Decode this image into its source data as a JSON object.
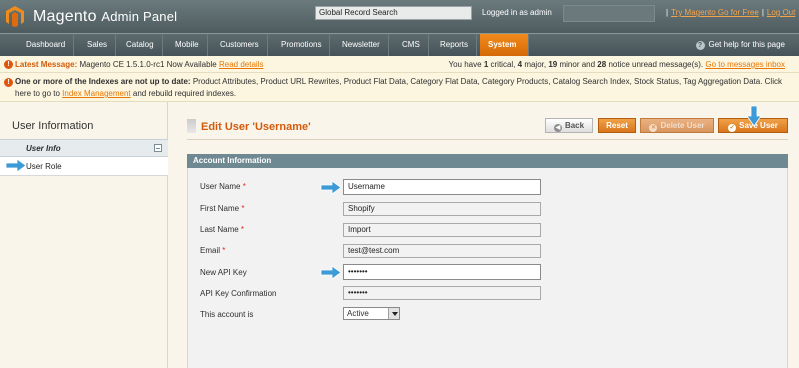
{
  "header": {
    "logo_brand": "Magento",
    "logo_suffix": "Admin Panel",
    "global_search": "Global Record Search",
    "logged_in": "Logged in as admin",
    "try_link": "Try Magento Go for Free",
    "logout_link": "Log Out"
  },
  "nav": {
    "items": [
      "Dashboard",
      "Sales",
      "Catalog",
      "Mobile",
      "Customers",
      "Promotions",
      "Newsletter",
      "CMS",
      "Reports",
      "System"
    ],
    "active": "System",
    "help": "Get help for this page"
  },
  "messages": {
    "latest_label": "Latest Message:",
    "latest_text": "Magento CE 1.5.1.0-rc1 Now Available",
    "read_details": "Read details",
    "unread_you_have": "You have",
    "unread_critical_num": "1",
    "unread_critical": "critical,",
    "unread_major_num": "4",
    "unread_major": "major,",
    "unread_minor_num": "19",
    "unread_minor": "minor and",
    "unread_notice_num": "28",
    "unread_notice": "notice unread message(s).",
    "inbox_link": "Go to messages inbox",
    "index_bold": "One or more of the Indexes are not up to date:",
    "index_text": "Product Attributes, Product URL Rewrites, Product Flat Data, Category Flat Data, Category Products, Catalog Search Index, Stock Status, Tag Aggregation Data. Click here to go to",
    "index_link": "Index Management",
    "index_tail": "and rebuild required indexes."
  },
  "sidebar": {
    "title": "User Information",
    "tabs": [
      "User Info",
      "User Role"
    ]
  },
  "page": {
    "title": "Edit User 'Username'",
    "buttons": {
      "back": "Back",
      "reset": "Reset",
      "delete": "Delete User",
      "save": "Save User"
    }
  },
  "form": {
    "section_title": "Account Information",
    "fields": [
      {
        "label": "User Name",
        "required": true,
        "value": "Username"
      },
      {
        "label": "First Name",
        "required": true,
        "value": "Shopify"
      },
      {
        "label": "Last Name",
        "required": true,
        "value": "Import"
      },
      {
        "label": "Email",
        "required": true,
        "value": "test@test.com"
      },
      {
        "label": "New API Key",
        "required": false,
        "value": "•••••••"
      },
      {
        "label": "API Key Confirmation",
        "required": false,
        "value": "•••••••"
      },
      {
        "label": "This account is",
        "required": false,
        "value": "Active"
      }
    ]
  },
  "colors": {
    "accent": "#d35b0c",
    "nav_active": "#e27a16",
    "fieldset_header": "#6f8992"
  }
}
